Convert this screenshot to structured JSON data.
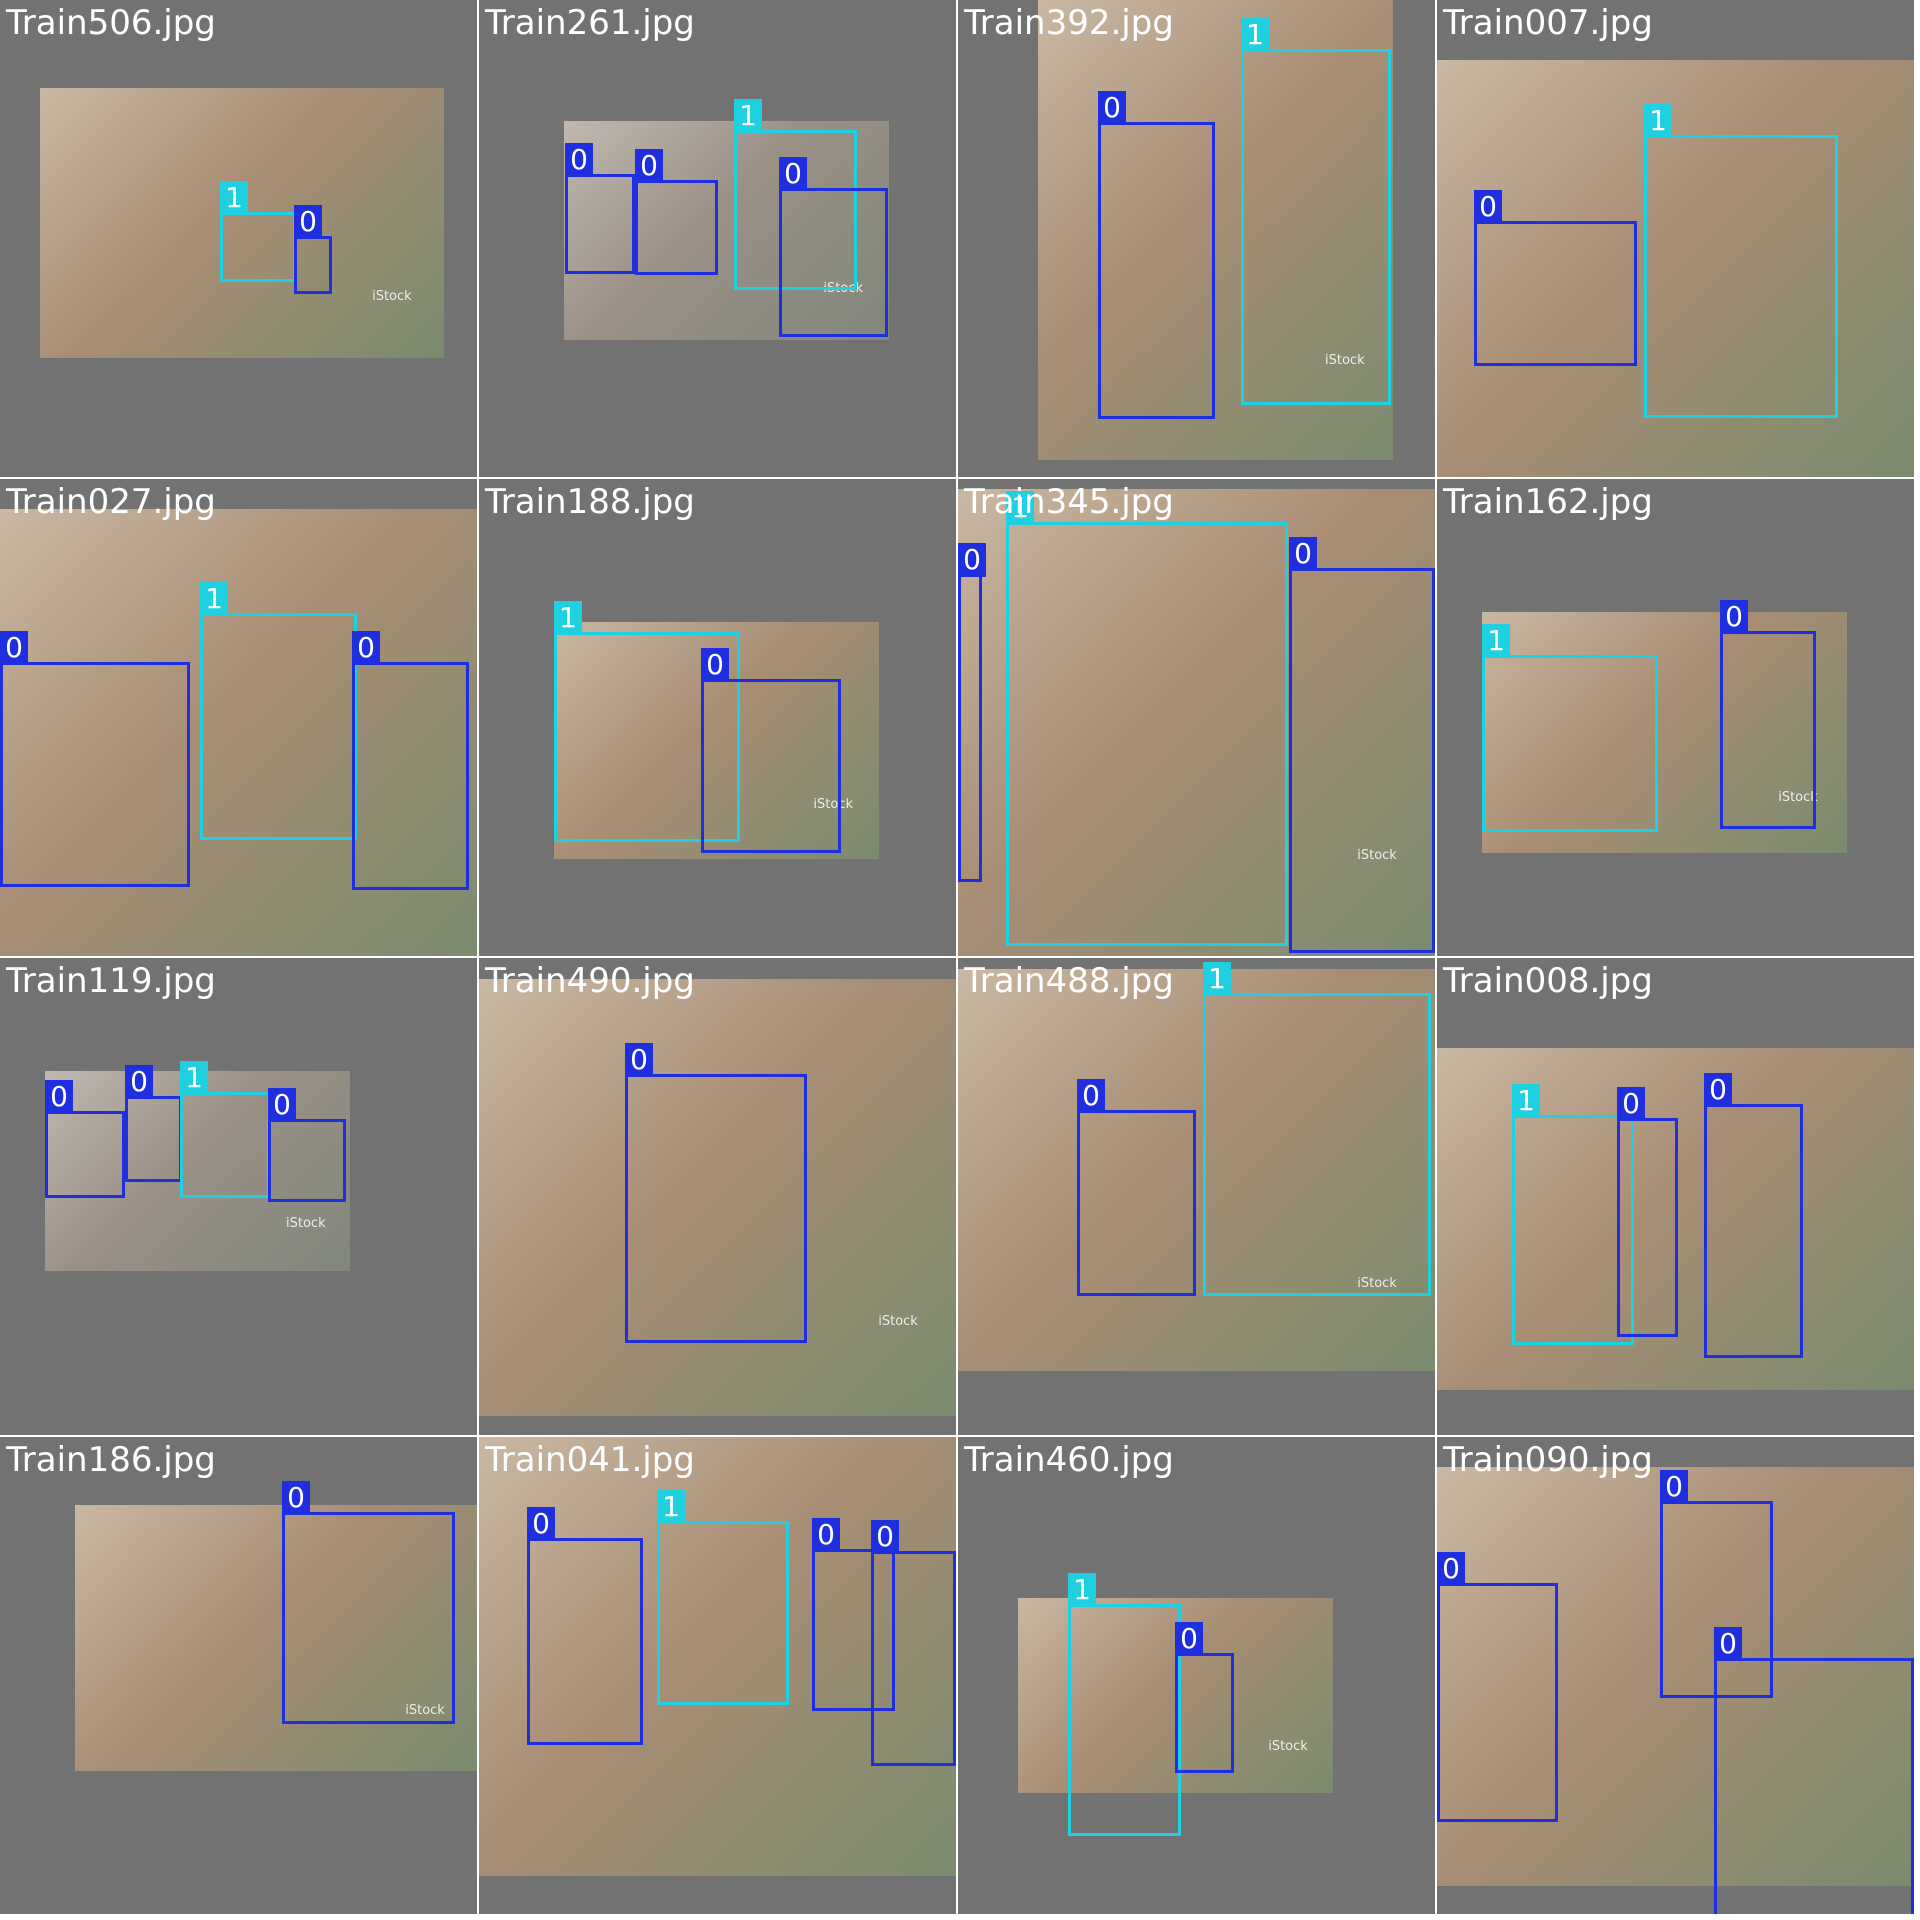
{
  "colors": {
    "class_0": "#1f2fe0",
    "class_1": "#1fd0e0",
    "tile_background": "#727272",
    "label_text": "#ffffff"
  },
  "tiles": [
    {
      "title": "Train506.jpg",
      "watermark": "iStock",
      "boxes": [
        {
          "cls": "1"
        },
        {
          "cls": "0"
        }
      ]
    },
    {
      "title": "Train261.jpg",
      "watermark": "iStock",
      "boxes": [
        {
          "cls": "0"
        },
        {
          "cls": "0"
        },
        {
          "cls": "1"
        },
        {
          "cls": "0"
        }
      ]
    },
    {
      "title": "Train392.jpg",
      "watermark": "iStock",
      "boxes": [
        {
          "cls": "0"
        },
        {
          "cls": "1"
        }
      ]
    },
    {
      "title": "Train007.jpg",
      "watermark": "",
      "boxes": [
        {
          "cls": "0"
        },
        {
          "cls": "1"
        }
      ]
    },
    {
      "title": "Train027.jpg",
      "watermark": "",
      "boxes": [
        {
          "cls": "0"
        },
        {
          "cls": "1"
        },
        {
          "cls": "0"
        }
      ]
    },
    {
      "title": "Train188.jpg",
      "watermark": "iStock",
      "boxes": [
        {
          "cls": "1"
        },
        {
          "cls": "0"
        }
      ]
    },
    {
      "title": "Train345.jpg",
      "watermark": "iStock",
      "boxes": [
        {
          "cls": "0"
        },
        {
          "cls": "1"
        },
        {
          "cls": "0"
        }
      ]
    },
    {
      "title": "Train162.jpg",
      "watermark": "iStock",
      "boxes": [
        {
          "cls": "1"
        },
        {
          "cls": "0"
        }
      ]
    },
    {
      "title": "Train119.jpg",
      "watermark": "iStock",
      "boxes": [
        {
          "cls": "0"
        },
        {
          "cls": "0"
        },
        {
          "cls": "1"
        },
        {
          "cls": "0"
        }
      ]
    },
    {
      "title": "Train490.jpg",
      "watermark": "iStock",
      "boxes": [
        {
          "cls": "0"
        }
      ]
    },
    {
      "title": "Train488.jpg",
      "watermark": "iStock",
      "boxes": [
        {
          "cls": "0"
        },
        {
          "cls": "1"
        }
      ]
    },
    {
      "title": "Train008.jpg",
      "watermark": "",
      "boxes": [
        {
          "cls": "1"
        },
        {
          "cls": "0"
        },
        {
          "cls": "0"
        }
      ]
    },
    {
      "title": "Train186.jpg",
      "watermark": "iStock",
      "boxes": [
        {
          "cls": "0"
        }
      ]
    },
    {
      "title": "Train041.jpg",
      "watermark": "",
      "boxes": [
        {
          "cls": "0"
        },
        {
          "cls": "1"
        },
        {
          "cls": "0"
        },
        {
          "cls": "0"
        }
      ]
    },
    {
      "title": "Train460.jpg",
      "watermark": "iStock",
      "boxes": [
        {
          "cls": "1"
        },
        {
          "cls": "0"
        }
      ]
    },
    {
      "title": "Train090.jpg",
      "watermark": "",
      "boxes": [
        {
          "cls": "0"
        },
        {
          "cls": "0"
        },
        {
          "cls": "0"
        }
      ]
    }
  ]
}
